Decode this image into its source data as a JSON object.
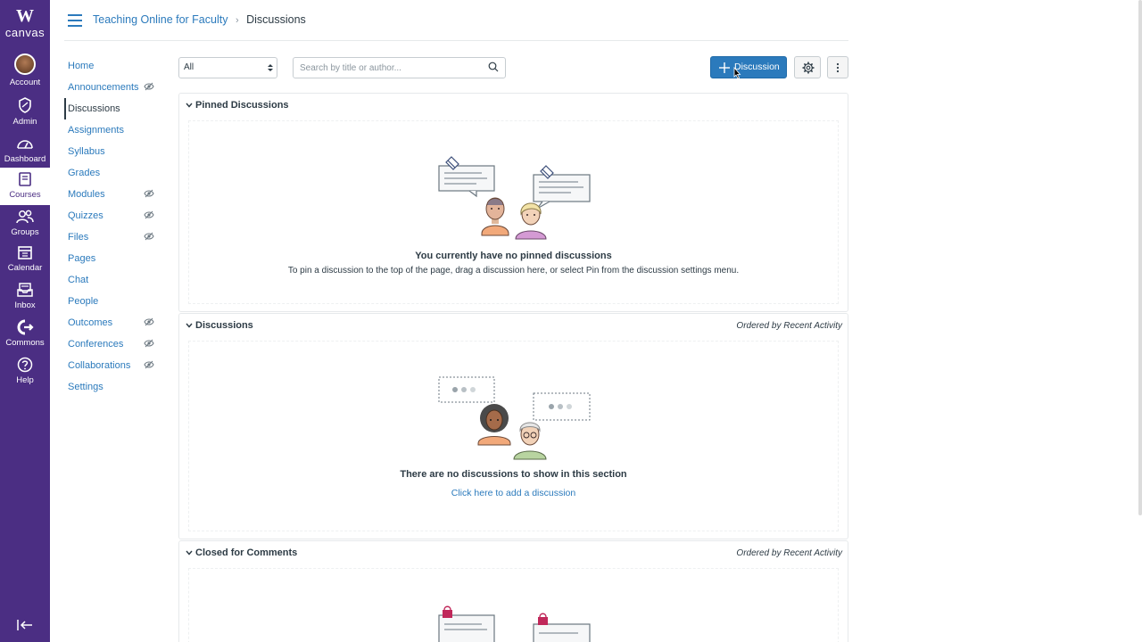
{
  "global_nav": {
    "logo_letter": "W",
    "logo_text": "canvas",
    "brand_color": "#4b2e83",
    "items": [
      {
        "label": "Account",
        "icon": "avatar"
      },
      {
        "label": "Admin",
        "icon": "shield-icon"
      },
      {
        "label": "Dashboard",
        "icon": "dashboard-icon"
      },
      {
        "label": "Courses",
        "icon": "book-icon",
        "active": true
      },
      {
        "label": "Groups",
        "icon": "groups-icon"
      },
      {
        "label": "Calendar",
        "icon": "calendar-icon"
      },
      {
        "label": "Inbox",
        "icon": "inbox-icon"
      },
      {
        "label": "Commons",
        "icon": "commons-icon"
      },
      {
        "label": "Help",
        "icon": "help-icon"
      }
    ]
  },
  "breadcrumb": {
    "course": "Teaching Online for Faculty",
    "separator": "›",
    "current": "Discussions"
  },
  "course_nav": {
    "items": [
      {
        "label": "Home",
        "hidden": false
      },
      {
        "label": "Announcements",
        "hidden": true
      },
      {
        "label": "Discussions",
        "hidden": false,
        "active": true
      },
      {
        "label": "Assignments",
        "hidden": false
      },
      {
        "label": "Syllabus",
        "hidden": false
      },
      {
        "label": "Grades",
        "hidden": false
      },
      {
        "label": "Modules",
        "hidden": true
      },
      {
        "label": "Quizzes",
        "hidden": true
      },
      {
        "label": "Files",
        "hidden": true
      },
      {
        "label": "Pages",
        "hidden": false
      },
      {
        "label": "Chat",
        "hidden": false
      },
      {
        "label": "People",
        "hidden": false
      },
      {
        "label": "Outcomes",
        "hidden": true
      },
      {
        "label": "Conferences",
        "hidden": true
      },
      {
        "label": "Collaborations",
        "hidden": true
      },
      {
        "label": "Settings",
        "hidden": false
      }
    ]
  },
  "toolbar": {
    "filter_value": "All",
    "search_placeholder": "Search by title or author...",
    "add_discussion_label": "Discussion",
    "accent_color": "#2b7abc"
  },
  "sections": {
    "pinned": {
      "title": "Pinned Discussions",
      "empty_title": "You currently have no pinned discussions",
      "empty_text": "To pin a discussion to the top of the page, drag a discussion here, or select Pin from the discussion settings menu."
    },
    "discussions": {
      "title": "Discussions",
      "order": "Ordered by Recent Activity",
      "empty_title": "There are no discussions to show in this section",
      "empty_link": "Click here to add a discussion"
    },
    "closed": {
      "title": "Closed for Comments",
      "order": "Ordered by Recent Activity"
    }
  }
}
